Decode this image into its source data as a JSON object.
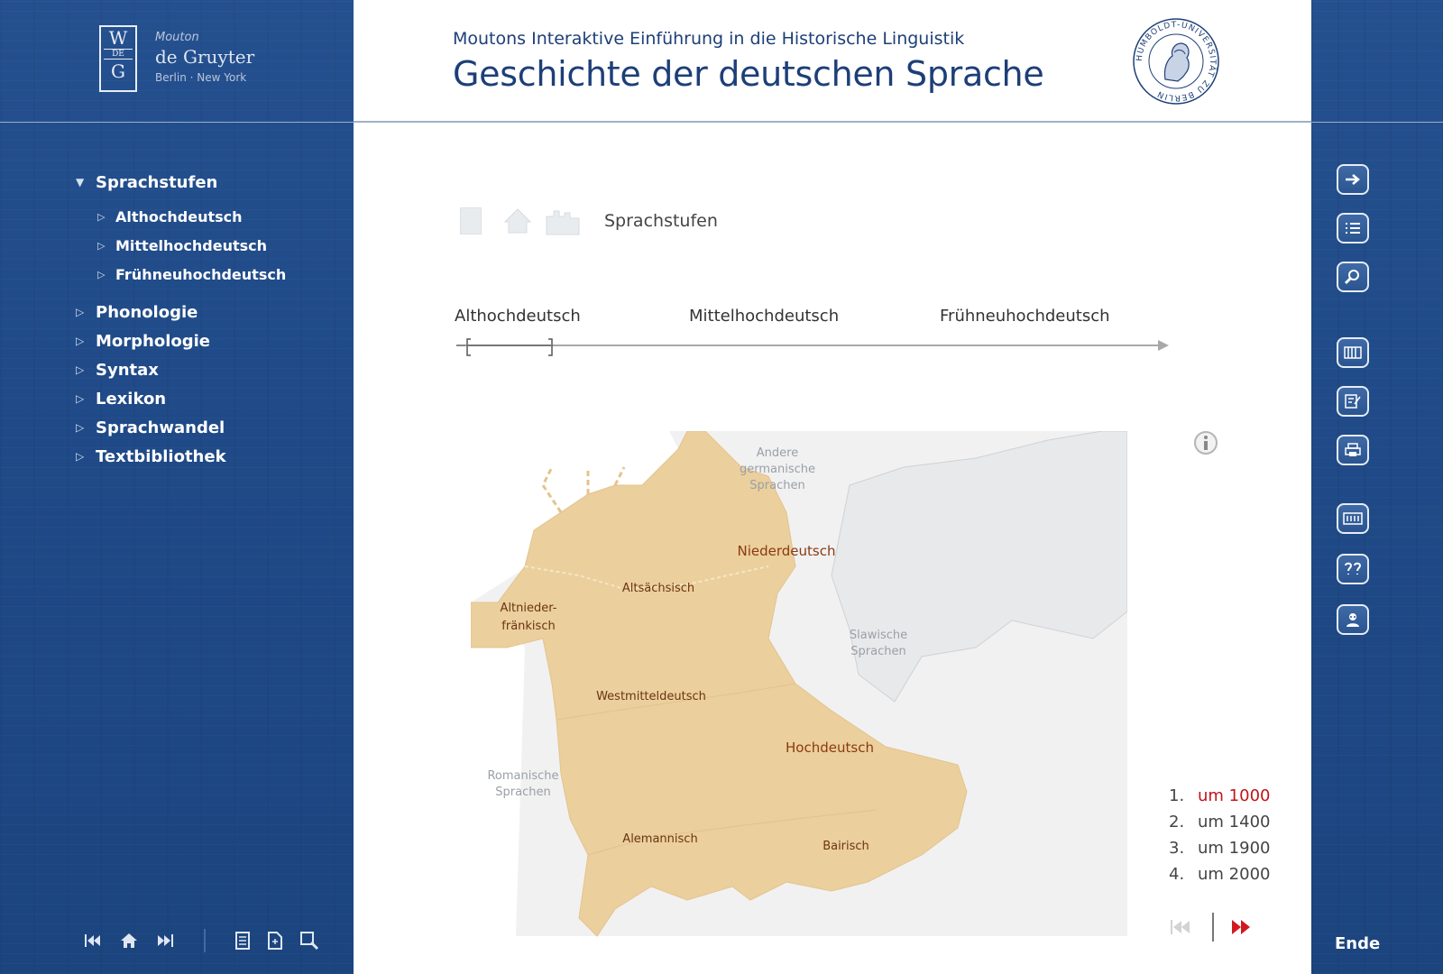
{
  "colors": {
    "panel_blue": "#1f4a87",
    "title_blue": "#1d3f78",
    "region_tan": "#ebcf9d",
    "active_red": "#c0151b",
    "label_brown": "#8a3a12"
  },
  "publisher": {
    "logo_letters": [
      "W",
      "DE",
      "G"
    ],
    "line1": "Mouton",
    "line2": "de Gruyter",
    "line3": "Berlin · New York"
  },
  "header": {
    "subtitle": "Moutons Interaktive Einführung in die Historische Linguistik",
    "title": "Geschichte der deutschen Sprache",
    "seal_text": "HUMBOLDT-UNIVERSITÄT ZU BERLIN"
  },
  "nav": {
    "open_section": "Sprachstufen",
    "sub_items": [
      "Althochdeutsch",
      "Mittelhochdeutsch",
      "Frühneuhochdeutsch"
    ],
    "sections": [
      "Phonologie",
      "Morphologie",
      "Syntax",
      "Lexikon",
      "Sprachwandel",
      "Textbibliothek"
    ]
  },
  "left_toolbar": {
    "icons": [
      "first-icon",
      "home-icon",
      "last-icon",
      "page-icon",
      "document-icon",
      "zoom-icon"
    ]
  },
  "right_toolbar": {
    "icons": [
      "arrow-right-icon",
      "list-icon",
      "search-icon",
      "library-icon",
      "notes-icon",
      "print-icon",
      "glossary-icon",
      "quiz-icon",
      "help-icon"
    ],
    "end_label": "Ende"
  },
  "breadcrumb": {
    "label": "Sprachstufen",
    "icons": [
      "page-icon",
      "house-icon",
      "buildings-icon"
    ]
  },
  "timeline": {
    "labels": [
      "Althochdeutsch",
      "Mittelhochdeutsch",
      "Frühneuhochdeutsch"
    ]
  },
  "map": {
    "labels": {
      "north_germanic": [
        "Andere",
        "germanische",
        "Sprachen"
      ],
      "slavic": [
        "Slawische",
        "Sprachen"
      ],
      "romance": [
        "Romanische",
        "Sprachen"
      ],
      "low_frankish": [
        "Altnieder-",
        "fränkisch"
      ],
      "niederdeutsch": "Niederdeutsch",
      "altsaechsisch": "Altsächsisch",
      "westmitteldeutsch": "Westmitteldeutsch",
      "hochdeutsch": "Hochdeutsch",
      "alemannisch": "Alemannisch",
      "bairisch": "Bairisch"
    }
  },
  "legend": {
    "items": [
      {
        "num": "1.",
        "label": "um 1000",
        "active": true
      },
      {
        "num": "2.",
        "label": "um 1400",
        "active": false
      },
      {
        "num": "3.",
        "label": "um 1900",
        "active": false
      },
      {
        "num": "4.",
        "label": "um 2000",
        "active": false
      }
    ]
  }
}
